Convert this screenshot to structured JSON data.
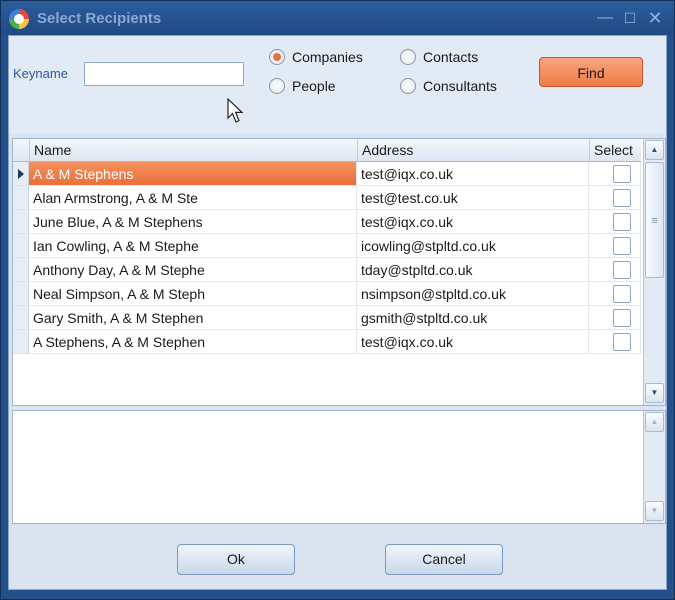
{
  "window": {
    "title": "Select Recipients"
  },
  "search": {
    "keyname_label": "Keyname",
    "keyname_value": "",
    "find_label": "Find"
  },
  "filters": {
    "companies": {
      "label": "Companies",
      "checked": true
    },
    "people": {
      "label": "People",
      "checked": false
    },
    "contacts": {
      "label": "Contacts",
      "checked": false
    },
    "consultants": {
      "label": "Consultants",
      "checked": false
    }
  },
  "grid": {
    "headers": {
      "name": "Name",
      "address": "Address",
      "select": "Select"
    },
    "rows": [
      {
        "name": "A & M Stephens",
        "address": "test@iqx.co.uk",
        "selected": true,
        "checked": false
      },
      {
        "name": "Alan Armstrong, A & M Ste",
        "address": "test@test.co.uk",
        "selected": false,
        "checked": false
      },
      {
        "name": "June Blue, A & M Stephens",
        "address": "test@iqx.co.uk",
        "selected": false,
        "checked": false
      },
      {
        "name": "Ian Cowling, A & M Stephe",
        "address": "icowling@stpltd.co.uk",
        "selected": false,
        "checked": false
      },
      {
        "name": "Anthony Day, A & M Stephe",
        "address": "tday@stpltd.co.uk",
        "selected": false,
        "checked": false
      },
      {
        "name": "Neal Simpson, A & M Steph",
        "address": "nsimpson@stpltd.co.uk",
        "selected": false,
        "checked": false
      },
      {
        "name": "Gary Smith, A & M Stephen",
        "address": "gsmith@stpltd.co.uk",
        "selected": false,
        "checked": false
      },
      {
        "name": "A Stephens, A & M Stephen",
        "address": "test@iqx.co.uk",
        "selected": false,
        "checked": false
      }
    ]
  },
  "footer": {
    "ok_label": "Ok",
    "cancel_label": "Cancel"
  },
  "colors": {
    "accent": "#ef7c4a",
    "titlebar": "#24508c"
  }
}
